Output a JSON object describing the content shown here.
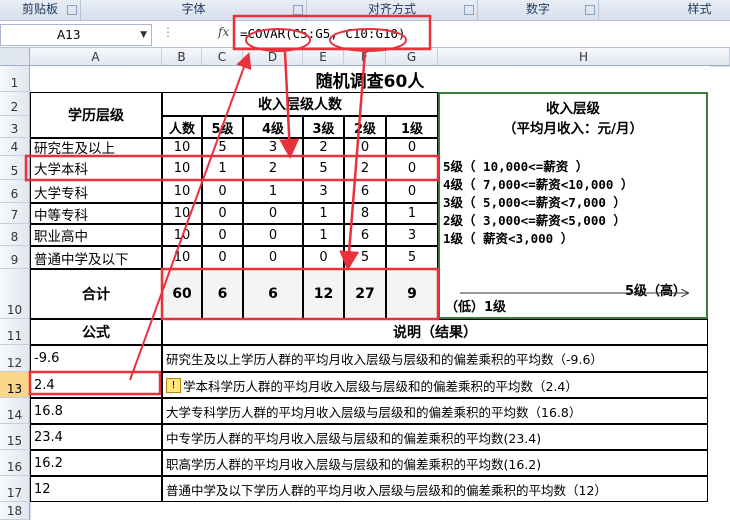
{
  "ribbon": {
    "groups": [
      "剪贴板",
      "字体",
      "对齐方式",
      "数字",
      "样式"
    ]
  },
  "formula_bar": {
    "name_box": "A13",
    "fx_label": "fx",
    "formula": "=COVAR(C5:G5, C10:G10)"
  },
  "columns": [
    "A",
    "B",
    "C",
    "D",
    "E",
    "F",
    "G",
    "H"
  ],
  "rows": [
    "1",
    "2",
    "3",
    "4",
    "5",
    "6",
    "7",
    "8",
    "9",
    "10",
    "11",
    "12",
    "13",
    "14",
    "15",
    "16",
    "17",
    "18"
  ],
  "sheet": {
    "title": "随机调查60人",
    "edu_header": "学历层级",
    "income_header": "收入层级人数",
    "level_header": [
      "人数",
      "5级",
      "4级",
      "3级",
      "2级",
      "1级"
    ],
    "data_rows": [
      {
        "label": "研究生及以上",
        "values": [
          "10",
          "5",
          "3",
          "2",
          "0",
          "0"
        ]
      },
      {
        "label": "大学本科",
        "values": [
          "10",
          "1",
          "2",
          "5",
          "2",
          "0"
        ]
      },
      {
        "label": "大学专科",
        "values": [
          "10",
          "0",
          "1",
          "3",
          "6",
          "0"
        ]
      },
      {
        "label": "中等专科",
        "values": [
          "10",
          "0",
          "0",
          "1",
          "8",
          "1"
        ]
      },
      {
        "label": "职业高中",
        "values": [
          "10",
          "0",
          "0",
          "1",
          "6",
          "3"
        ]
      },
      {
        "label": "普通中学及以下",
        "values": [
          "10",
          "0",
          "0",
          "0",
          "5",
          "5"
        ]
      }
    ],
    "total_label": "合计",
    "totals": [
      "60",
      "6",
      "6",
      "12",
      "27",
      "9"
    ],
    "legend": {
      "title_line1": "收入层级",
      "title_line2": "（平均月收入：元/月）",
      "levels": [
        "5级（  10,000<=薪资  ）",
        "4级（  7,000<=薪资<10,000  ）",
        "3级（  5,000<=薪资<7,000  ）",
        "2级（  3,000<=薪资<5,000  ）",
        "1级（  薪资<3,000  ）"
      ],
      "high_label": "5级（高）",
      "low_label": "（低）1级"
    },
    "formula_header": "公式",
    "desc_header": "说明（结果）",
    "results": [
      {
        "value": "-9.6",
        "desc": "研究生及以上学历人群的平均月收入层级与层级和的偏差乘积的平均数（-9.6）"
      },
      {
        "value": "2.4",
        "desc": "学本科学历人群的平均月收入层级与层级和的偏差乘积的平均数（2.4）"
      },
      {
        "value": "16.8",
        "desc": "大学专科学历人群的平均月收入层级与层级和的偏差乘积的平均数（16.8）"
      },
      {
        "value": "23.4",
        "desc": "中专学历人群的平均月收入层级与层级和的偏差乘积的平均数(23.4)"
      },
      {
        "value": "16.2",
        "desc": "职高学历人群的平均月收入层级与层级和的偏差乘积的平均数(16.2)"
      },
      {
        "value": "12",
        "desc": "普通中学及以下学历人群的平均月收入层级与层级和的偏差乘积的平均数（12）"
      }
    ]
  },
  "colors": {
    "highlight": "#e8313b",
    "legend_border": "#3a7a3a",
    "selected_row": "#f8d68a"
  }
}
